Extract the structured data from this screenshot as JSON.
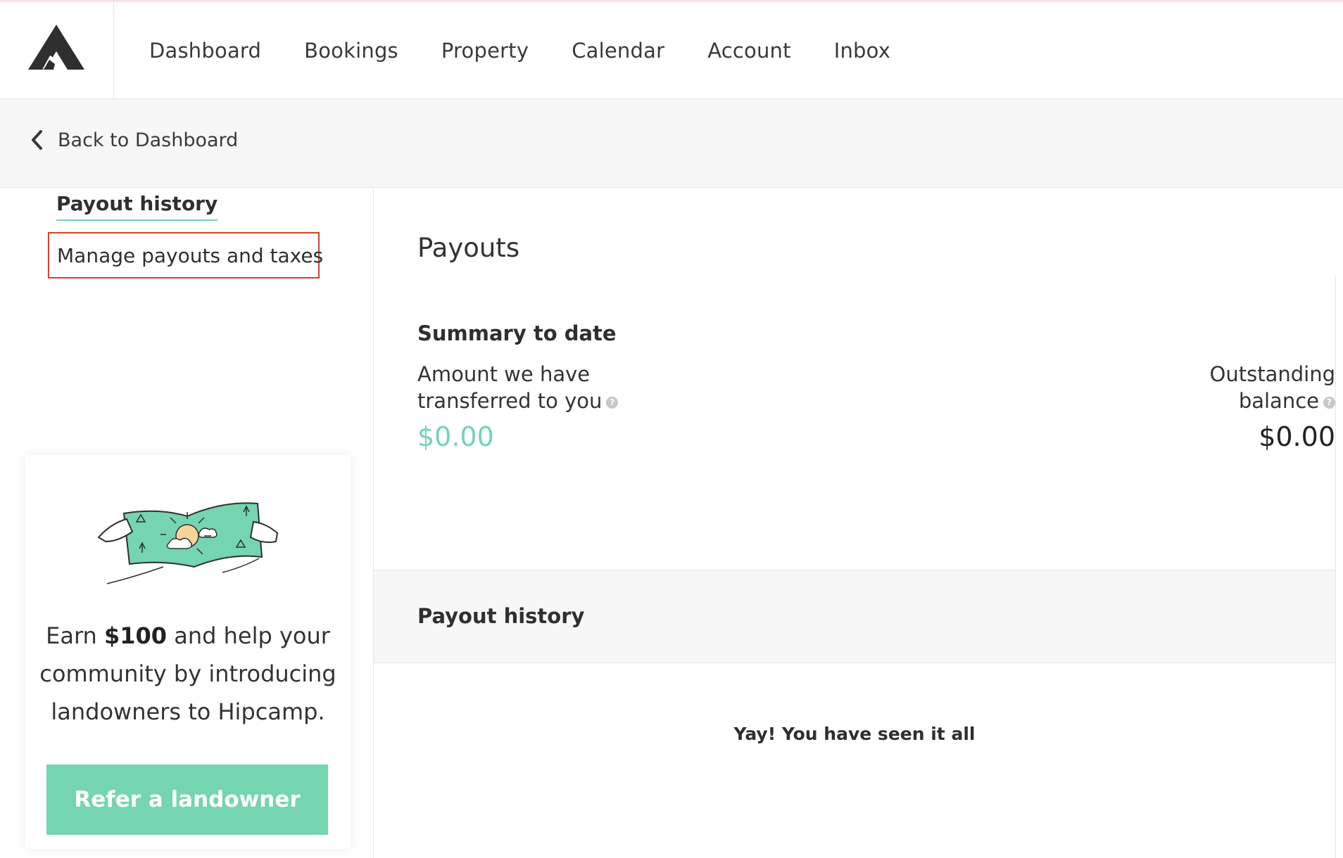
{
  "colors": {
    "accent": "#74d5b0",
    "highlight_border": "#d9412e",
    "text": "#333333",
    "band": "#f7f7f7"
  },
  "header": {
    "logo_icon": "hipcamp-logo-icon",
    "nav": [
      {
        "label": "Dashboard"
      },
      {
        "label": "Bookings"
      },
      {
        "label": "Property"
      },
      {
        "label": "Calendar"
      },
      {
        "label": "Account"
      },
      {
        "label": "Inbox"
      }
    ]
  },
  "back_bar": {
    "icon": "chevron-left-icon",
    "label": "Back to Dashboard"
  },
  "sidebar": {
    "active_item": "Payout history",
    "link_item": "Manage payouts and taxes",
    "referral": {
      "illustration": "money-bill-illustration",
      "text_before": "Earn ",
      "text_amount": "$100",
      "text_after": " and help your community by introducing landowners to Hipcamp.",
      "button": "Refer a landowner"
    }
  },
  "main": {
    "title": "Payouts",
    "summary_title": "Summary to date",
    "transferred": {
      "label": "Amount we have transferred to you",
      "value": "$0.00",
      "help_icon": "question-circle-icon"
    },
    "outstanding": {
      "label": "Outstanding balance",
      "value": "$0.00",
      "help_icon": "question-circle-icon"
    },
    "history_title": "Payout history",
    "empty_message": "Yay! You have seen it all"
  }
}
